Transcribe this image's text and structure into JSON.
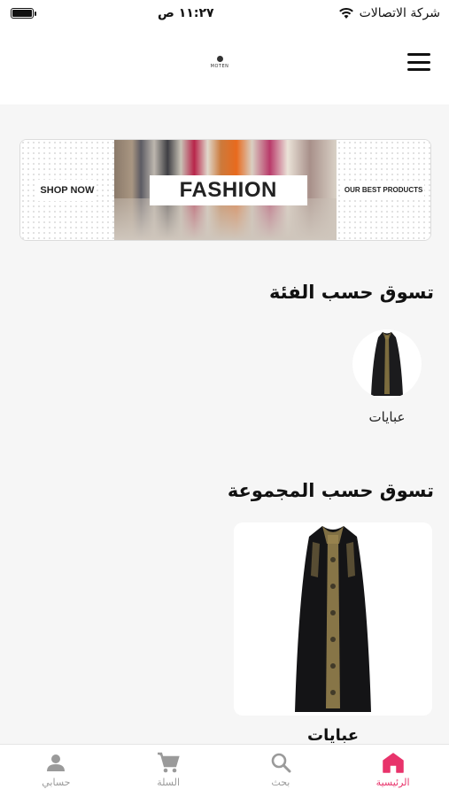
{
  "status_bar": {
    "carrier": "شركة الاتصالات",
    "time": "١١:٢٧ ص"
  },
  "header": {
    "logo_text": "MOTEN"
  },
  "banner": {
    "left_text": "SHOP NOW",
    "center_text": "FASHION",
    "right_text": "OUR BEST PRODUCTS"
  },
  "categories_section": {
    "title": "تسوق حسب الفئة",
    "items": [
      {
        "label": "عبايات"
      }
    ]
  },
  "collections_section": {
    "title": "تسوق حسب المجموعة",
    "items": [
      {
        "label": "عبايات"
      }
    ]
  },
  "bottom_nav": {
    "items": [
      {
        "label": "حسابي",
        "icon": "person-icon"
      },
      {
        "label": "السلة",
        "icon": "cart-icon"
      },
      {
        "label": "بحث",
        "icon": "search-icon"
      },
      {
        "label": "الرئيسية",
        "icon": "home-icon",
        "active": true
      }
    ]
  },
  "colors": {
    "accent": "#e8336b",
    "inactive": "#9a9a9a"
  }
}
